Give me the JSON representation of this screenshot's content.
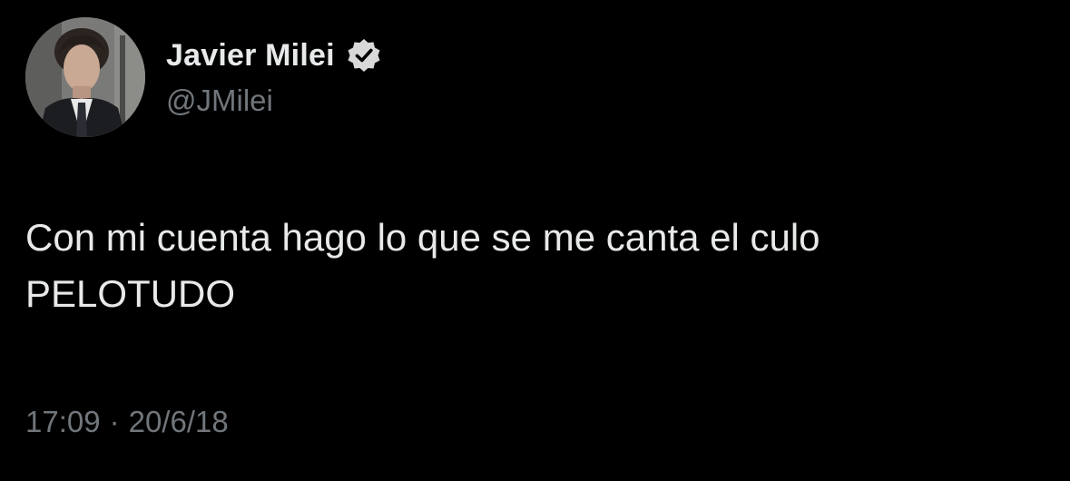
{
  "author": {
    "name": "Javier Milei",
    "handle": "@JMilei",
    "verified": true
  },
  "tweet": {
    "lines": [
      "Con mi cuenta hago lo que se me canta el culo",
      "PELOTUDO"
    ]
  },
  "meta": {
    "time": "17:09",
    "separator": "·",
    "date": "20/6/18"
  },
  "colors": {
    "background": "#000000",
    "primary_text": "#e7e9ea",
    "secondary_text": "#71767b",
    "verified_badge": "#d9d9d9"
  },
  "icons": {
    "verified": "verified-badge-icon",
    "avatar": "profile-photo"
  }
}
